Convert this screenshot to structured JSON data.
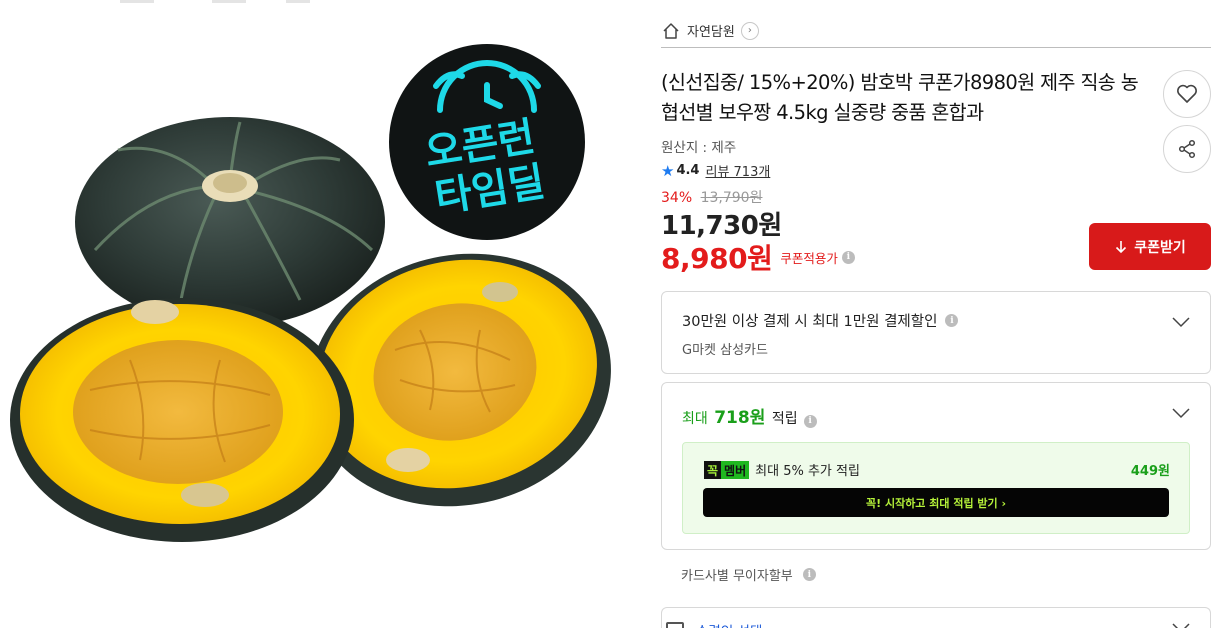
{
  "seller": {
    "name": "자연담원"
  },
  "product": {
    "title": "(신선집중/ 15%+20%) 밤호박 쿠폰가8980원 제주 직송 농협선별 보우짱 4.5kg 실중량 중품 혼합과",
    "origin": "원산지 : 제주",
    "rating": "4.4",
    "review_label": "리뷰 713개",
    "discount_rate": "34%",
    "original_price": "13,790원",
    "price": "11,730원",
    "coupon_price": "8,980원",
    "coupon_price_label": "쿠폰적용가"
  },
  "badge": {
    "line1": "오픈런",
    "line2": "타임딜"
  },
  "buttons": {
    "coupon": "쿠폰받기"
  },
  "card_benefit": {
    "title": "30만원 이상 결제 시 최대 1만원 결제할인",
    "sub": "G마켓 삼성카드"
  },
  "points": {
    "prefix": "최대",
    "amount": "718원",
    "suffix": "적립",
    "member_logo_k": "꼭",
    "member_logo_m": "멤버",
    "member_text": "최대 5% 추가 적립",
    "member_amount": "449원",
    "member_cta": "꼭! 시작하고 최대 적립 받기 ›"
  },
  "installment": "카드사별 무이자할부",
  "bottom_option": "수령인 선택",
  "colors": {
    "accent_red": "#e31c1c",
    "coupon_button": "#d81a1a",
    "points_green": "#1a9f1a",
    "star_blue": "#1e7bf0",
    "badge_cyan": "#1ed9e8"
  },
  "icons": [
    "home-icon",
    "chevron-right-icon",
    "heart-icon",
    "share-icon",
    "star-icon",
    "info-icon",
    "download-arrow-icon",
    "chevron-down-icon",
    "alarm-clock-icon"
  ]
}
